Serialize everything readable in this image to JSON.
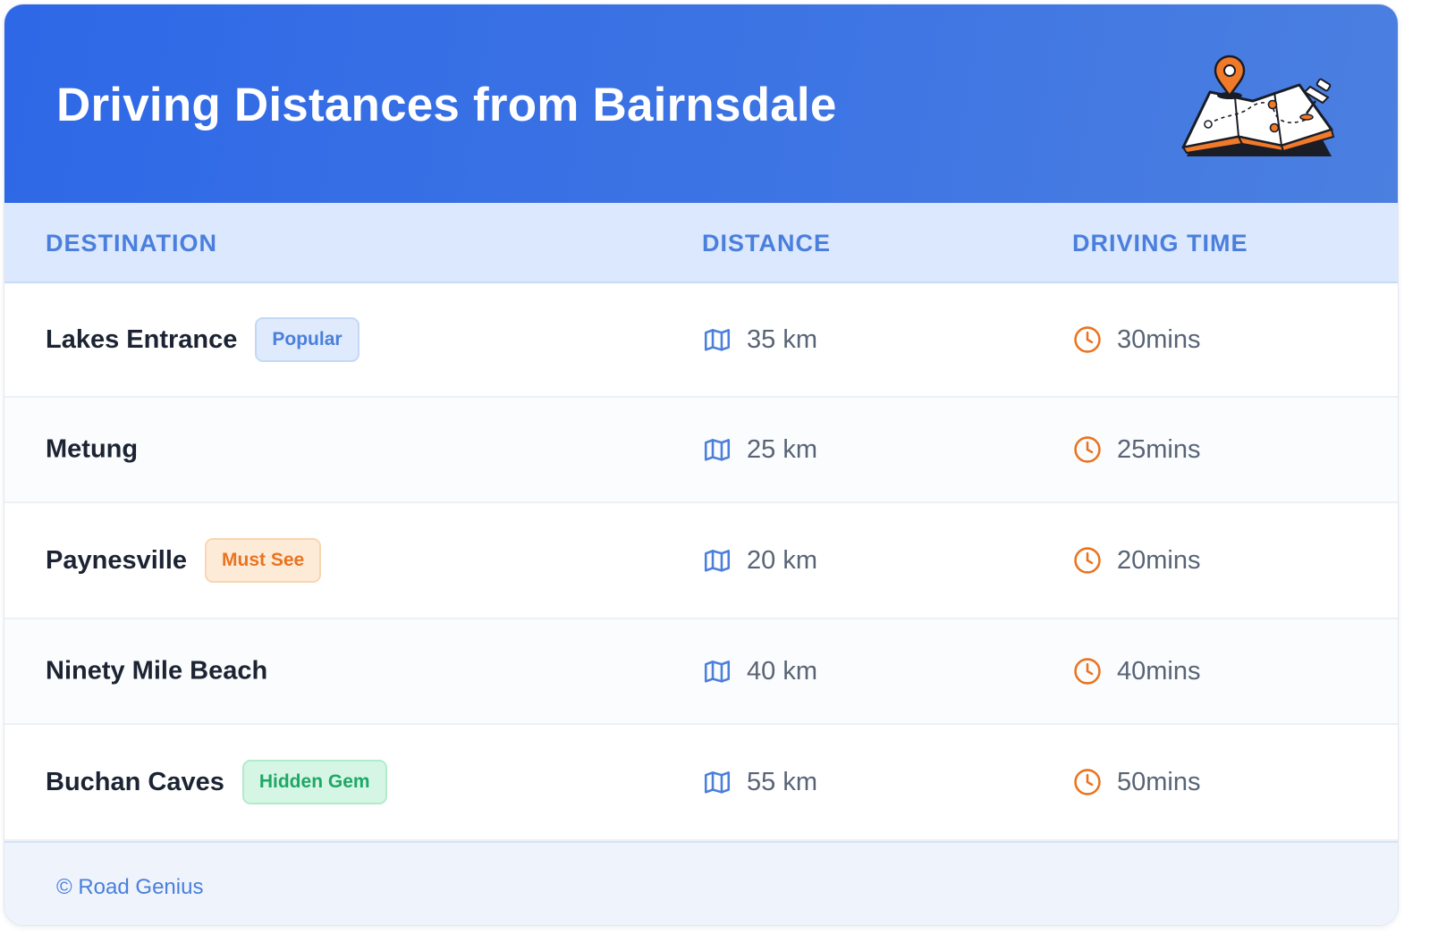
{
  "header": {
    "title": "Driving Distances from Bairnsdale",
    "illustration": "map-with-pins-icon"
  },
  "table": {
    "columns": [
      "DESTINATION",
      "DISTANCE",
      "DRIVING TIME"
    ],
    "rows": [
      {
        "destination": "Lakes Entrance",
        "badge": "Popular",
        "badge_style": "blue",
        "distance": "35 km",
        "time": "30mins"
      },
      {
        "destination": "Metung",
        "badge": "",
        "badge_style": "",
        "distance": "25 km",
        "time": "25mins"
      },
      {
        "destination": "Paynesville",
        "badge": "Must See",
        "badge_style": "orange",
        "distance": "20 km",
        "time": "20mins"
      },
      {
        "destination": "Ninety Mile Beach",
        "badge": "",
        "badge_style": "",
        "distance": "40 km",
        "time": "40mins"
      },
      {
        "destination": "Buchan Caves",
        "badge": "Hidden Gem",
        "badge_style": "green",
        "distance": "55 km",
        "time": "50mins"
      }
    ],
    "distance_icon": "map-icon",
    "time_icon": "clock-icon"
  },
  "footer": {
    "text": "© Road Genius"
  },
  "colors": {
    "header_gradient_start": "#2e68e6",
    "header_gradient_end": "#4b7fe0",
    "accent_blue": "#4a7fdc",
    "accent_orange": "#ea7320",
    "accent_green": "#1ea865",
    "table_header_bg": "#dbe8fd"
  }
}
